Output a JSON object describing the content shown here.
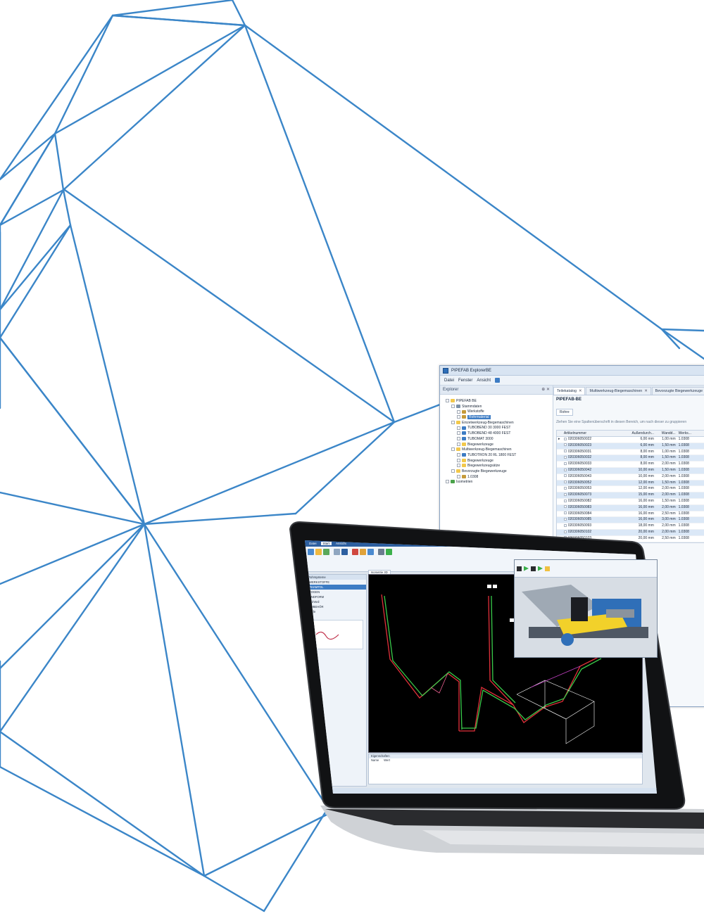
{
  "window": {
    "title": "PIPEFAB ExplorerBE",
    "menu": [
      "Datei",
      "Fenster",
      "Ansicht"
    ]
  },
  "explorer": {
    "title": "Explorer",
    "pin_glyph": "⊕",
    "close_glyph": "✕",
    "tree": [
      {
        "label": "PIPEFAB BE",
        "level": 0,
        "icon": "folder-icon"
      },
      {
        "label": "Stammdaten",
        "level": 1,
        "icon": "database-icon"
      },
      {
        "label": "Werkstoffe",
        "level": 2,
        "icon": "material-icon"
      },
      {
        "label": "Rohrmaterial",
        "level": 2,
        "icon": "material-icon",
        "selected": true
      },
      {
        "label": "Einzelwerkzeug-Biegemaschinen",
        "level": 1,
        "icon": "folder-icon"
      },
      {
        "label": "TUBOBEND 30 3000 FEST",
        "level": 2,
        "icon": "machine-icon"
      },
      {
        "label": "TUBOBEND 48 4000 FEST",
        "level": 2,
        "icon": "machine-icon"
      },
      {
        "label": "TUBOMAT 3000",
        "level": 2,
        "icon": "machine-icon"
      },
      {
        "label": "Biegewerkzeuge",
        "level": 2,
        "icon": "folder-icon"
      },
      {
        "label": "Multiwerkzeug-Biegemaschinen",
        "level": 1,
        "icon": "folder-icon"
      },
      {
        "label": "TUBOTRON 20 RL 1800 FEST",
        "level": 2,
        "icon": "machine-icon"
      },
      {
        "label": "Biegewerkzeuge",
        "level": 2,
        "icon": "folder-icon"
      },
      {
        "label": "Biegewerkzeugsätze",
        "level": 2,
        "icon": "folder-icon"
      },
      {
        "label": "Bevorzugte Biegewerkzeuge",
        "level": 1,
        "icon": "folder-icon"
      },
      {
        "label": "1.0308",
        "level": 2,
        "icon": "material-icon"
      },
      {
        "label": "Isometrien",
        "level": 0,
        "icon": "isometry-icon"
      }
    ]
  },
  "tabs": [
    {
      "label": "Teilekatalog",
      "active": true
    },
    {
      "label": "Multiwerkzeug-Biegemaschinen",
      "active": false
    },
    {
      "label": "Bevorzugte Biegewerkzeuge",
      "active": false
    }
  ],
  "catalog": {
    "heading": "PIPEFAB-BE",
    "filter_button": "Rohre",
    "group_hint": "Ziehen Sie eine Spaltenüberschrift in diesen Bereich, um nach dieser zu gruppieren",
    "columns": [
      "Artikelnummer",
      "Außendurch...",
      "Wandd...",
      "Werks..."
    ],
    "rows": [
      [
        "020306050022",
        "6,00 mm",
        "1,00 mm",
        "1.0308"
      ],
      [
        "020306050023",
        "6,00 mm",
        "1,50 mm",
        "1.0308"
      ],
      [
        "020306050031",
        "8,00 mm",
        "1,00 mm",
        "1.0308"
      ],
      [
        "020306050032",
        "8,00 mm",
        "1,50 mm",
        "1.0308"
      ],
      [
        "020306050033",
        "8,00 mm",
        "2,00 mm",
        "1.0308"
      ],
      [
        "020306050042",
        "10,00 mm",
        "1,50 mm",
        "1.0308"
      ],
      [
        "020306050043",
        "10,00 mm",
        "2,00 mm",
        "1.0308"
      ],
      [
        "020306050052",
        "12,00 mm",
        "1,50 mm",
        "1.0308"
      ],
      [
        "020306050053",
        "12,00 mm",
        "2,00 mm",
        "1.0308"
      ],
      [
        "020306050073",
        "15,00 mm",
        "2,00 mm",
        "1.0308"
      ],
      [
        "020306050082",
        "16,00 mm",
        "1,50 mm",
        "1.0308"
      ],
      [
        "020306050083",
        "16,00 mm",
        "2,00 mm",
        "1.0308"
      ],
      [
        "020306050084",
        "16,00 mm",
        "2,50 mm",
        "1.0308"
      ],
      [
        "020306050085",
        "16,00 mm",
        "3,00 mm",
        "1.0308"
      ],
      [
        "020306050093",
        "18,00 mm",
        "2,00 mm",
        "1.0308"
      ],
      [
        "020306050102",
        "20,00 mm",
        "2,00 mm",
        "1.0308"
      ],
      [
        "020306050103",
        "20,00 mm",
        "2,50 mm",
        "1.0308"
      ]
    ],
    "visible_tail": [
      [
        "20,00 mm",
        "3,00 mm",
        "1.0308"
      ],
      [
        "22,00 mm",
        "2,00 mm",
        "1.0308"
      ],
      [
        "22,00 mm",
        "2,50 mm",
        "1.0308"
      ],
      [
        "25,00 mm",
        "2,00 mm",
        "1.0308"
      ],
      [
        "25,00 mm",
        "2,50 mm",
        "1.0308"
      ],
      [
        "25,00 mm",
        "3,00 mm",
        "1.0308"
      ],
      [
        "28,00 mm",
        "2,50 mm",
        "1.0308"
      ],
      [
        "30,00 mm",
        "3,00 mm",
        "1.0308"
      ],
      [
        "30,00 mm",
        "4,00 mm",
        "1.0308"
      ],
      [
        "35,00 mm",
        "1,50 mm",
        "1.0308"
      ],
      [
        "35,00 mm",
        "2,00 mm",
        "1.0308"
      ],
      [
        "35,00 mm",
        "2,50 mm",
        "1.0308"
      ],
      [
        "38,00 mm",
        "4,00 mm",
        "1.0308"
      ],
      [
        "40,00 mm",
        "3,00 mm",
        "1.0308"
      ],
      [
        "40,00 mm",
        "2,00 mm",
        "1.0308"
      ],
      [
        "42,00 mm",
        "2,50 mm",
        "1.0308"
      ],
      [
        "42,00 mm",
        "3,00 mm",
        "1.0308"
      ],
      [
        "44,00 mm",
        "4,00 mm",
        "1.0308"
      ],
      [
        "45,00 mm",
        "2,00 mm",
        "1.0308"
      ]
    ]
  },
  "laptop_app": {
    "ribbon_tabs": [
      "Datei",
      "Start",
      "Ansicht"
    ],
    "left_panel_title": "Rohrsysteme",
    "left_items": [
      "WERKSTOFFE",
      "RHAMTOL",
      "BOGEN",
      "ENDFORM",
      "Rohrteil",
      "ZUBEHÖR",
      "Mufe"
    ],
    "viewport_tab": "Isometrie 3D",
    "properties_title": "Eigenschaften",
    "properties_rows": [
      [
        "Name",
        "Wert"
      ]
    ],
    "status": "Bereit"
  },
  "colors": {
    "mesh": "#3b86c8",
    "accent": "#3d7cc4",
    "row_alt": "#dbe8f7",
    "pipe_red": "#e0303a",
    "pipe_green": "#39c94a"
  }
}
